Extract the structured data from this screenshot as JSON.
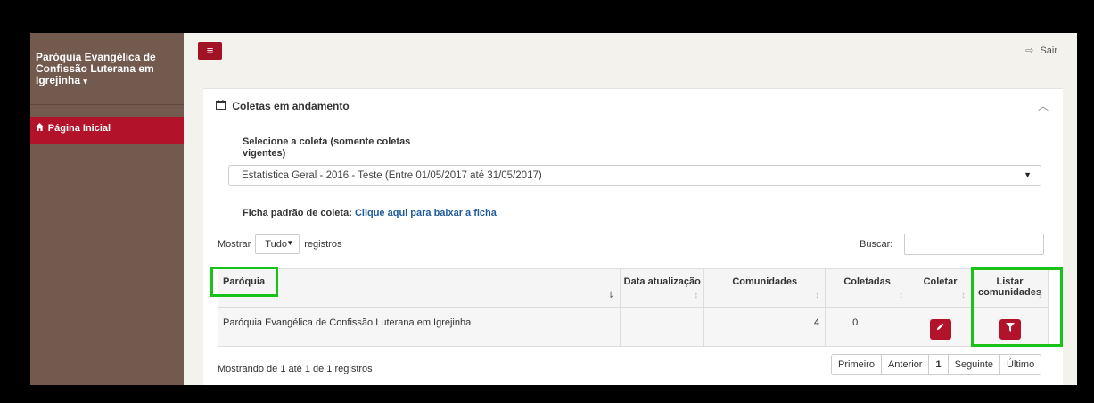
{
  "sidebar": {
    "brand": "Paróquia Evangélica de Confissão Luterana em Igrejinha",
    "brand_caret": "▾",
    "nav": [
      {
        "label": "Página Inicial",
        "icon": "home-icon"
      }
    ]
  },
  "topbar": {
    "menu_icon": "≡",
    "logout_icon": "⇨",
    "logout_label": "Sair"
  },
  "panel": {
    "title": "Coletas em andamento",
    "calendar_icon": "▭",
    "collapse_icon": "︿",
    "select_label": "Selecione a coleta (somente coletas vigentes)",
    "select_value": "Estatística Geral - 2016 - Teste (Entre 01/05/2017 até 31/05/2017)",
    "ficha_label": "Ficha padrão de coleta:",
    "ficha_link": "Clique aqui para baixar a ficha",
    "show_label": "Mostrar",
    "show_value": "Tudo",
    "records_label": "registros",
    "search_label": "Buscar:",
    "search_value": ""
  },
  "table": {
    "headers": [
      "Paróquia",
      "Data atualização",
      "Comunidades",
      "Coletadas",
      "Coletar",
      "Listar comunidades"
    ],
    "rows": [
      {
        "paroquia": "Paróquia Evangélica de Confissão Luterana em Igrejinha",
        "data": "",
        "comunidades": "4",
        "coletadas": "0"
      }
    ]
  },
  "footer": {
    "info": "Mostrando de 1 até 1 de 1 registros",
    "pager": [
      "Primeiro",
      "Anterior",
      "1",
      "Seguinte",
      "Último"
    ]
  },
  "colors": {
    "sidebar": "#735a4f",
    "accent": "#b3122b",
    "highlight": "#19c219"
  }
}
